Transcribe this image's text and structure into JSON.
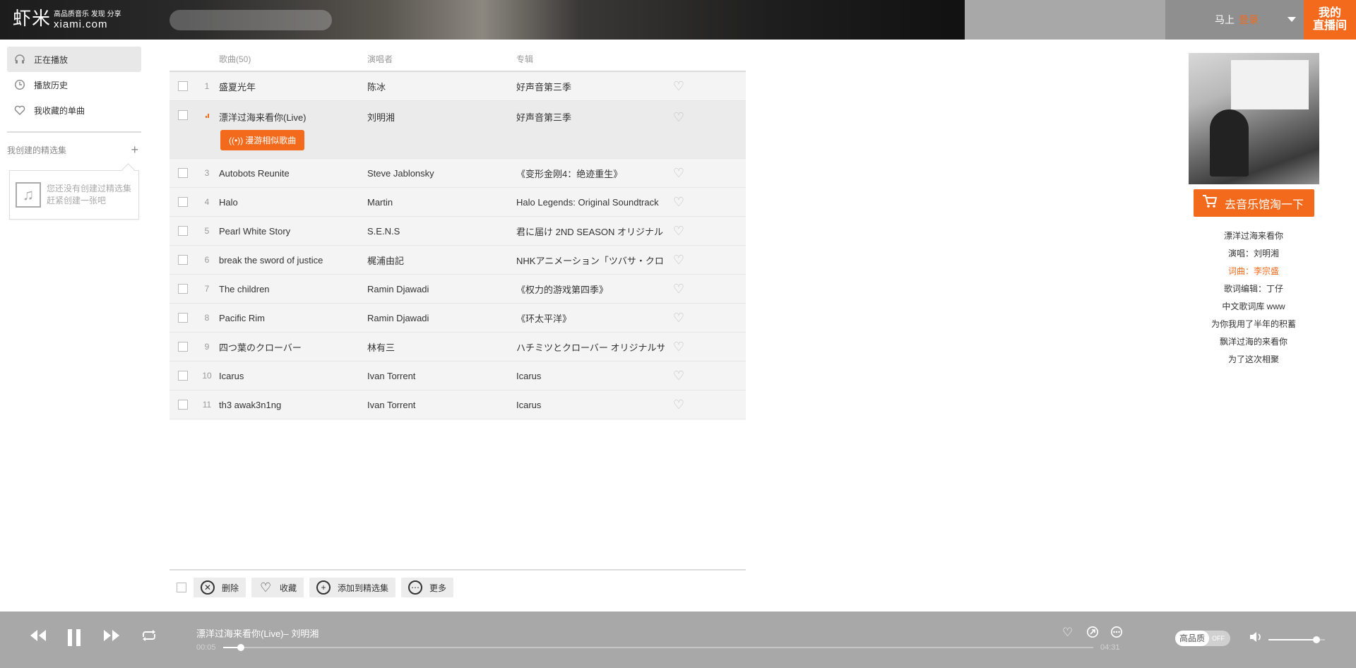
{
  "header": {
    "logo_cn": "虾米",
    "logo_slogan": "高品质音乐 发现 分享",
    "logo_domain": "xiami.com",
    "search_placeholder": "",
    "user_prefix": "马上",
    "user_login": "登录",
    "live_line1": "我的",
    "live_line2": "直播间"
  },
  "sidebar": {
    "items": [
      {
        "label": "正在播放",
        "icon": "headphones-icon"
      },
      {
        "label": "播放历史",
        "icon": "clock-icon"
      },
      {
        "label": "我收藏的单曲",
        "icon": "heart-icon"
      }
    ],
    "collections_title": "我创建的精选集",
    "add_symbol": "+",
    "empty_line1": "您还没有创建过精选集",
    "empty_line2": "赶紧创建一张吧"
  },
  "table": {
    "col_song": "歌曲(50)",
    "col_artist": "演唱者",
    "col_album": "专辑",
    "roam_label": "漫游相似歌曲",
    "rows": [
      {
        "num": "1",
        "title": "盛夏光年",
        "artist": "陈冰",
        "album": "好声音第三季",
        "playing": false
      },
      {
        "num": "2",
        "title": "漂洋过海来看你(Live)",
        "artist": "刘明湘",
        "album": "好声音第三季",
        "playing": true
      },
      {
        "num": "3",
        "title": "Autobots Reunite",
        "artist": "Steve Jablonsky",
        "album": "《变形金刚4：绝迹重生》",
        "playing": false
      },
      {
        "num": "4",
        "title": "Halo",
        "artist": "Martin",
        "album": "Halo Legends: Original Soundtrack",
        "playing": false
      },
      {
        "num": "5",
        "title": "Pearl White Story",
        "artist": "S.E.N.S",
        "album": "君に届け 2ND SEASON オリジナル・",
        "playing": false
      },
      {
        "num": "6",
        "title": "break the sword of justice",
        "artist": "梶浦由記",
        "album": "NHKアニメーション「ツバサ・クロニ",
        "playing": false
      },
      {
        "num": "7",
        "title": "The children",
        "artist": "Ramin Djawadi",
        "album": "《权力的游戏第四季》",
        "playing": false
      },
      {
        "num": "8",
        "title": "Pacific Rim",
        "artist": "Ramin Djawadi",
        "album": "《环太平洋》",
        "playing": false
      },
      {
        "num": "9",
        "title": "四つ葉のクローバー",
        "artist": "林有三",
        "album": "ハチミツとクローバー オリジナルサウ",
        "playing": false
      },
      {
        "num": "10",
        "title": "Icarus",
        "artist": "Ivan Torrent",
        "album": "Icarus",
        "playing": false
      },
      {
        "num": "11",
        "title": "th3 awak3n1ng",
        "artist": "Ivan Torrent",
        "album": "Icarus",
        "playing": false
      }
    ]
  },
  "footer": {
    "delete_label": "删除",
    "collect_label": "收藏",
    "add_collection_label": "添加到精选集",
    "more_label": "更多"
  },
  "right_panel": {
    "taobao_label": "去音乐馆淘一下",
    "lyrics": [
      {
        "text": "漂洋过海来看你",
        "highlight": false
      },
      {
        "text": "演唱：刘明湘",
        "highlight": false
      },
      {
        "text": "词曲：李宗盛",
        "highlight": true
      },
      {
        "text": "歌词编辑：丁仔",
        "highlight": false
      },
      {
        "text": "中文歌词库 www",
        "highlight": false
      },
      {
        "text": "为你我用了半年的积蓄",
        "highlight": false
      },
      {
        "text": "飘洋过海的来看你",
        "highlight": false
      },
      {
        "text": "为了这次相聚",
        "highlight": false
      }
    ]
  },
  "player": {
    "title": "漂洋过海来看你(Live)",
    "artist_sep": "– 刘明湘",
    "current_time": "00:05",
    "total_time": "04:31",
    "progress": 0.02,
    "quality_label": "高品质",
    "quality_state": "OFF",
    "volume": 0.85
  },
  "colors": {
    "accent": "#f36a1c",
    "player_bg": "#a8a8a8"
  }
}
